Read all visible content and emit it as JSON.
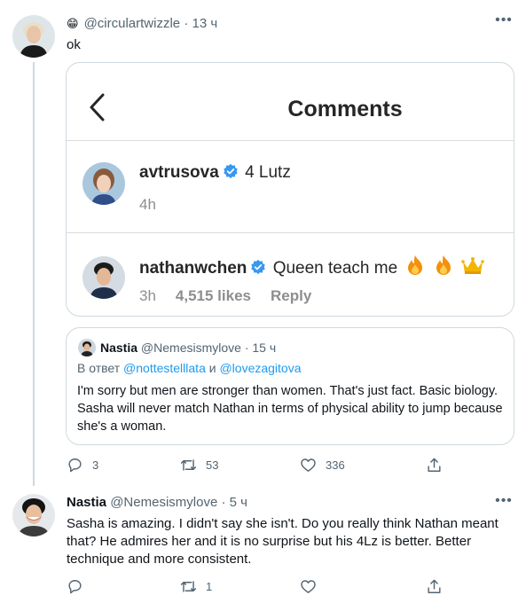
{
  "tweet1": {
    "handle_emoji": "😁",
    "handle": "@circulartwizzle",
    "separator": "·",
    "time": "13 ч",
    "text": "ok"
  },
  "embedded_screenshot": {
    "title": "Comments",
    "comments": [
      {
        "username": "avtrusova",
        "text": "4 Lutz",
        "time": "4h"
      },
      {
        "username": "nathanwchen",
        "text": "Queen teach me",
        "time": "3h",
        "likes": "4,515 likes",
        "reply": "Reply"
      }
    ]
  },
  "quote": {
    "name": "Nastia",
    "handle": "@Nemesismylove",
    "separator": "·",
    "time": "15 ч",
    "reply_prefix": "В ответ",
    "mention1": "@nottestelllata",
    "reply_and": "и",
    "mention2": "@lovezagitova",
    "text": "I'm sorry but men are stronger than women. That's just fact. Basic biology. Sasha will never match Nathan in terms of physical ability to jump because she's a woman."
  },
  "tweet1_actions": {
    "replies": "3",
    "retweets": "53",
    "likes": "336"
  },
  "tweet2": {
    "name": "Nastia",
    "handle": "@Nemesismylove",
    "separator": "·",
    "time": "5 ч",
    "text": "Sasha is amazing. I didn't say she isn't. Do you really think Nathan meant that? He admires her and it is no surprise but his 4Lz is better. Better technique and more consistent."
  },
  "tweet2_actions": {
    "replies": "",
    "retweets": "1",
    "likes": ""
  },
  "more_glyph": "•••",
  "colors": {
    "text_primary": "#0f1419",
    "text_secondary": "#536471",
    "border": "#cfd9de",
    "link_blue": "#1d9bf0",
    "verified_blue": "#3897f0"
  }
}
